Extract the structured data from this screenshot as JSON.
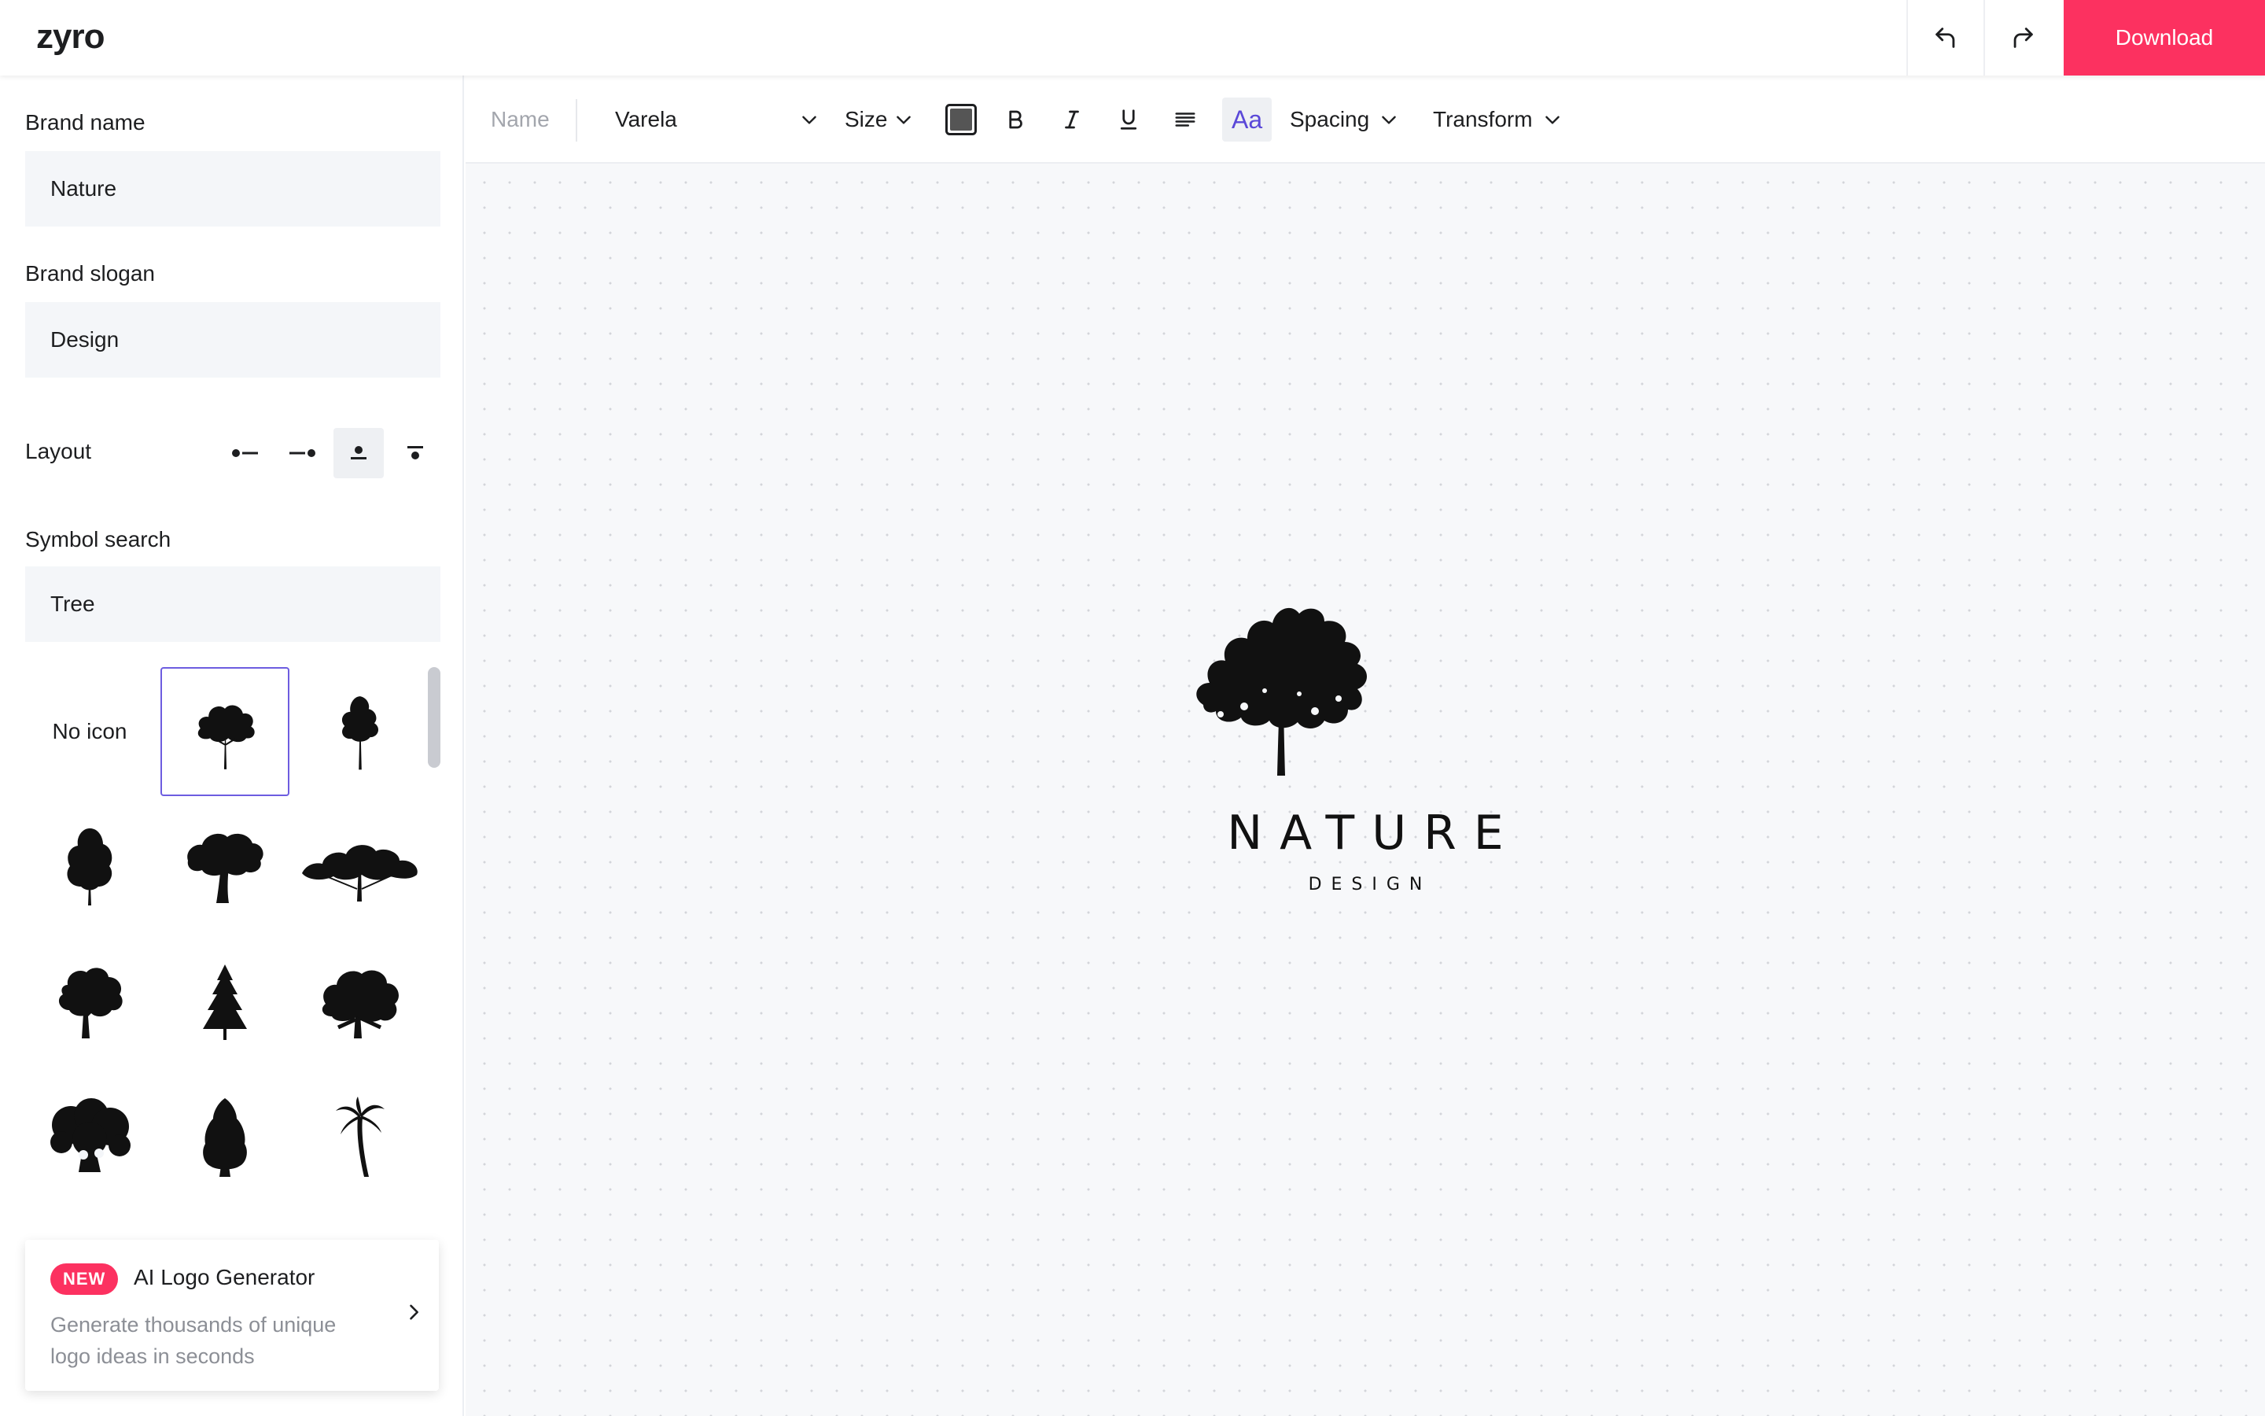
{
  "app": {
    "logo": "zyro"
  },
  "header": {
    "download_label": "Download"
  },
  "sidebar": {
    "brand_name_label": "Brand name",
    "brand_name_value": "Nature",
    "brand_slogan_label": "Brand slogan",
    "brand_slogan_value": "Design",
    "layout_label": "Layout",
    "layout_options": [
      "icon-left",
      "icon-right",
      "icon-top",
      "icon-top-bar"
    ],
    "layout_selected": "icon-top",
    "symbol_search_label": "Symbol search",
    "symbol_search_value": "Tree",
    "no_icon_label": "No icon",
    "symbols": [
      "tree-1",
      "tree-2",
      "tree-3",
      "tree-4",
      "tree-5",
      "tree-6",
      "pine-tree",
      "tree-7",
      "tree-8",
      "tree-9",
      "palm-tree"
    ],
    "promo": {
      "badge": "NEW",
      "title": "AI Logo Generator",
      "description": "Generate thousands of unique logo ideas in seconds"
    }
  },
  "toolbar": {
    "name_placeholder": "Name",
    "font": "Varela",
    "size_label": "Size",
    "spacing_label": "Spacing",
    "transform_label": "Transform",
    "aa_label": "Aa",
    "text_color": "#555555"
  },
  "canvas": {
    "brand_name": "NATURE",
    "slogan": "DESIGN"
  },
  "colors": {
    "accent": "#fc3160",
    "selection": "#6d5de0",
    "field_bg": "#f4f6f9"
  }
}
